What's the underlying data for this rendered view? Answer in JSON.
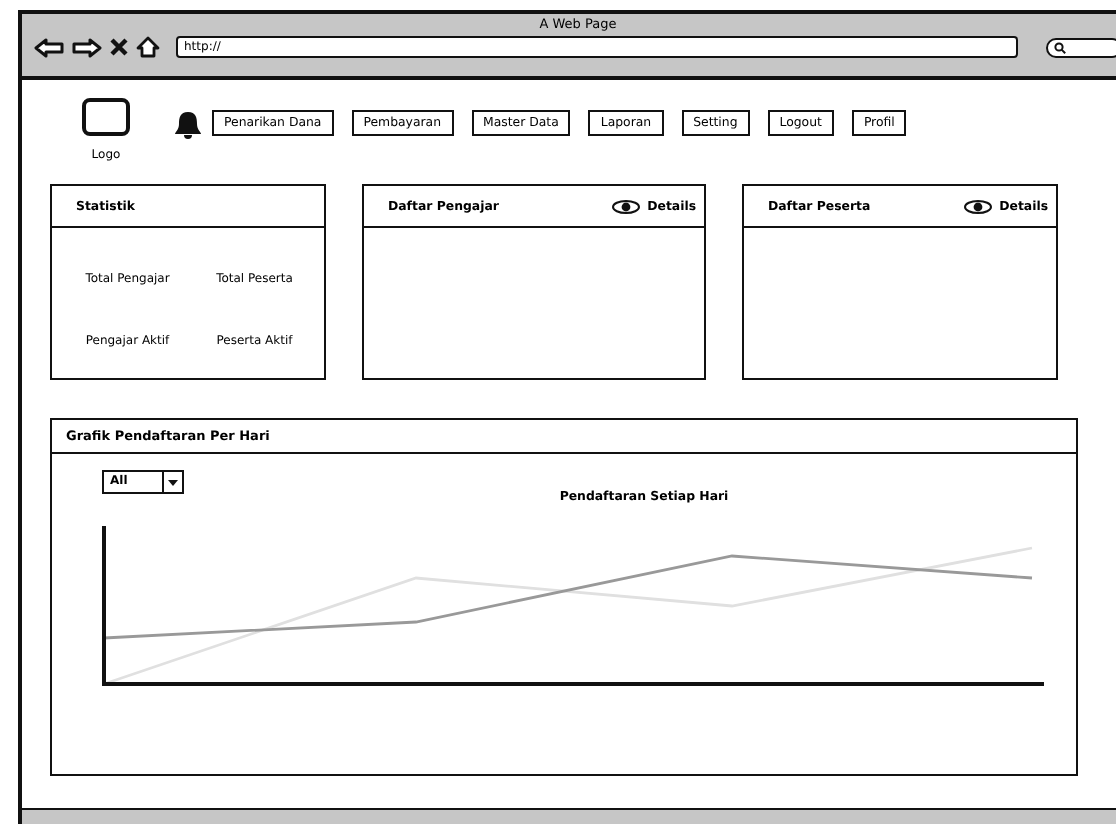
{
  "browser": {
    "title": "A Web Page",
    "url": "http://"
  },
  "nav": {
    "logo_label": "Logo",
    "buttons": [
      "Penarikan Dana",
      "Pembayaran",
      "Master Data",
      "Laporan",
      "Setting",
      "Logout",
      "Profil"
    ]
  },
  "cards": [
    {
      "kind": "stats",
      "title": "Statistik",
      "stats": [
        "Total Pengajar",
        "Total Peserta",
        "Pengajar Aktif",
        "Peserta Aktif"
      ]
    },
    {
      "kind": "list",
      "title": "Daftar Pengajar",
      "action": "Details"
    },
    {
      "kind": "list",
      "title": "Daftar Peserta",
      "action": "Details"
    }
  ],
  "chart_panel": {
    "title": "Grafik Pendaftaran Per Hari",
    "filter": "All",
    "chart_title": "Pendaftaran Setiap Hari"
  }
}
